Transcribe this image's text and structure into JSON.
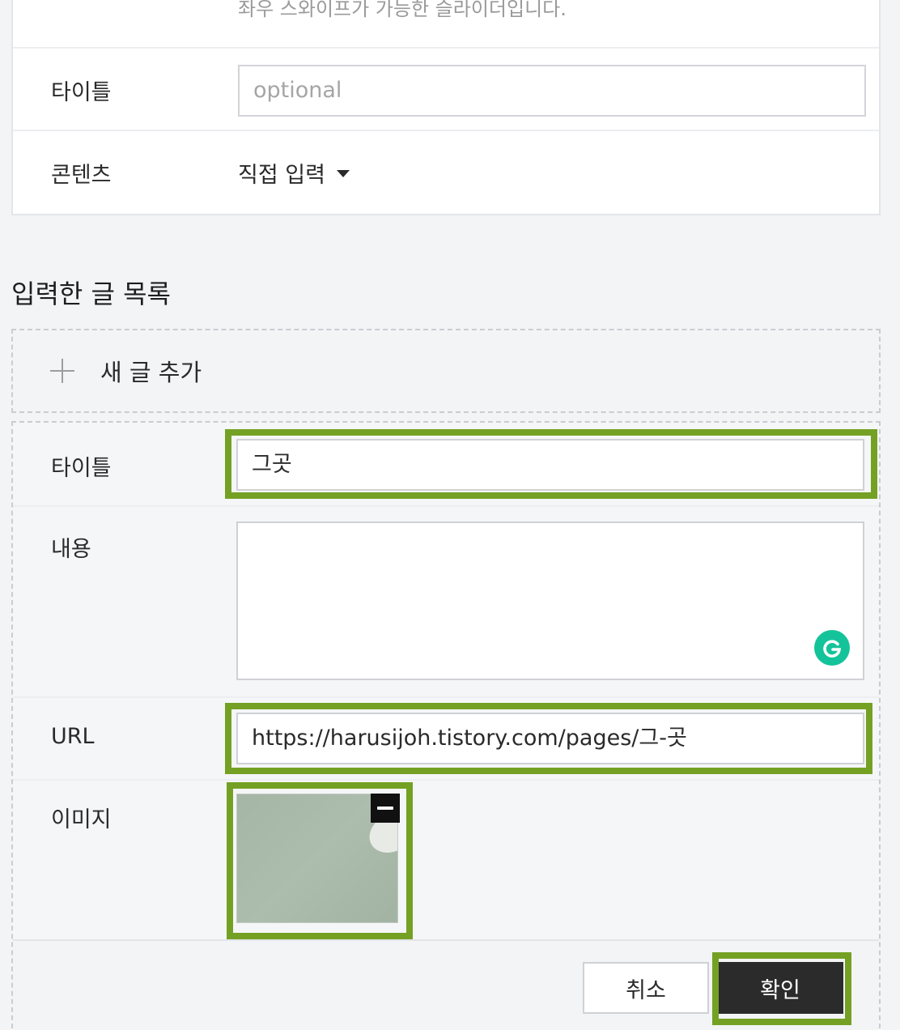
{
  "settings": {
    "hint": "좌우 스와이프가 가능한 슬라이더입니다.",
    "title_label": "타이틀",
    "title_placeholder": "optional",
    "content_label": "콘텐츠",
    "content_select_value": "직접 입력"
  },
  "list": {
    "section_title": "입력한 글 목록",
    "add_label": "새 글 추가"
  },
  "editor": {
    "title_label": "타이틀",
    "title_value": "그곳",
    "content_label": "내용",
    "content_value": "",
    "url_label": "URL",
    "url_value": "https://harusijoh.tistory.com/pages/그-곳",
    "image_label": "이미지"
  },
  "actions": {
    "cancel_label": "취소",
    "confirm_label": "확인"
  },
  "colors": {
    "highlight": "#74a124",
    "grammarly": "#15c39a",
    "confirm_bg": "#2b2b2b"
  },
  "icons": {
    "add": "plus-icon",
    "select": "caret-down-icon",
    "grammarly": "grammarly-icon",
    "remove_image": "minus-icon"
  }
}
